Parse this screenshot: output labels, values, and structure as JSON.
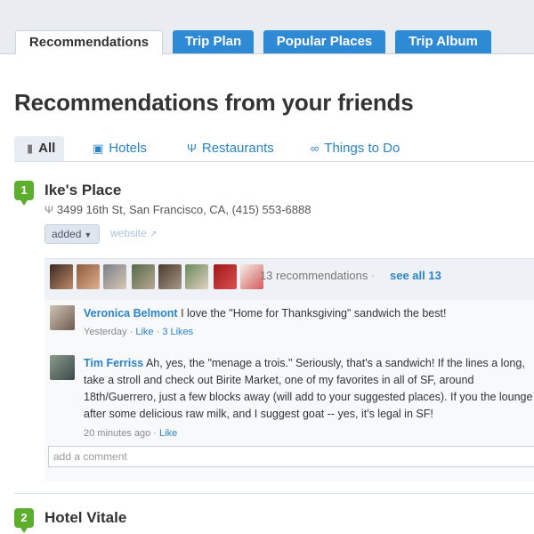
{
  "tabs": [
    {
      "label": "Recommendations",
      "active": true
    },
    {
      "label": "Trip Plan",
      "active": false
    },
    {
      "label": "Popular Places",
      "active": false
    },
    {
      "label": "Trip Album",
      "active": false
    }
  ],
  "page_title": "Recommendations from your friends",
  "filters": [
    {
      "label": "All",
      "icon": "comment-icon",
      "active": true
    },
    {
      "label": "Hotels",
      "icon": "bed-icon",
      "active": false
    },
    {
      "label": "Restaurants",
      "icon": "fork-knife-icon",
      "active": false
    },
    {
      "label": "Things to Do",
      "icon": "binoculars-icon",
      "active": false
    }
  ],
  "places": [
    {
      "number": "1",
      "name": "Ike's Place",
      "address": "3499 16th St, San Francisco, CA, (415) 553-6888",
      "added_label": "added",
      "website_label": "website",
      "recommendations_text": "13 recommendations",
      "see_all_label": "see all 13",
      "comments": [
        {
          "author": "Veronica Belmont",
          "text": " I love the \"Home for Thanksgiving\" sandwich the best!",
          "time": "Yesterday",
          "like_label": "Like",
          "likes_count": "3 Likes"
        },
        {
          "author": "Tim Ferriss",
          "text": " Ah, yes, the \"menage a trois.\" Seriously, that's a sandwich! If the lines a long, take a stroll and check out Birite Market, one of my favorites in all of SF, around 18th/Guerrero, just a few blocks away (will add to your suggested places). If you the lounge after some delicious raw milk, and I suggest goat -- yes, it's legal in SF!",
          "time": "20 minutes ago",
          "like_label": "Like"
        }
      ],
      "comment_placeholder": "add a comment"
    },
    {
      "number": "2",
      "name": "Hotel Vitale"
    }
  ],
  "colors": {
    "tab_blue": "#2f8ad6",
    "link_blue": "#2a83c9",
    "pin_green": "#5cae2c",
    "panel_bg": "#eef2f6"
  }
}
